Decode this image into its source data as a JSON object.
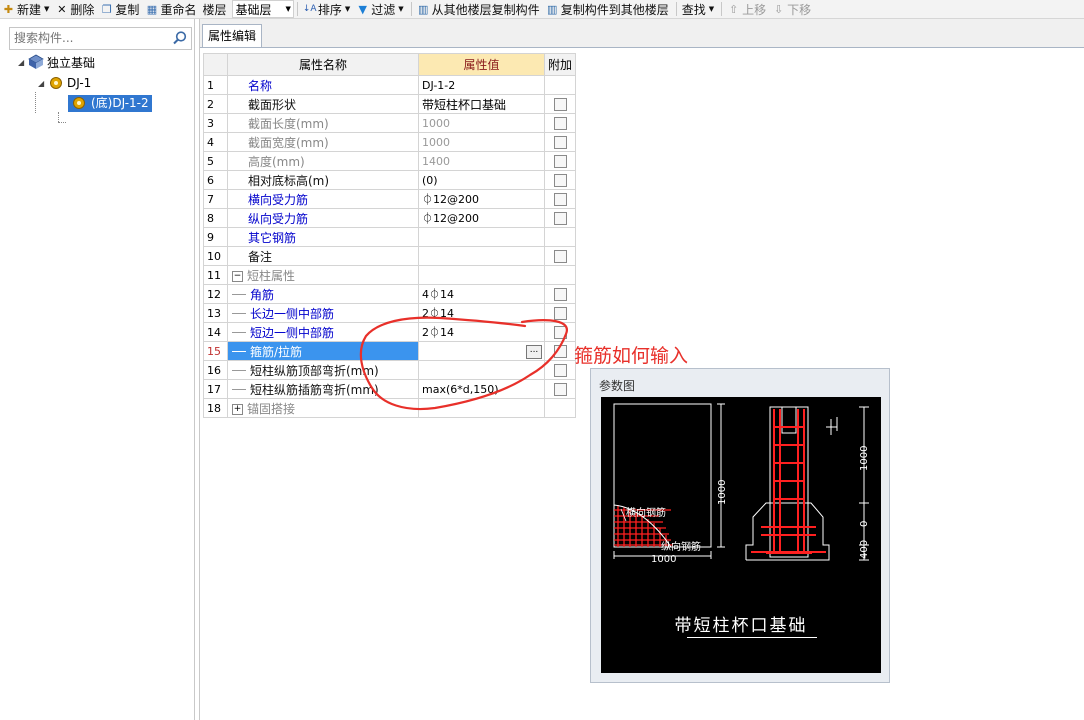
{
  "toolbar": {
    "new": "新建",
    "delete": "删除",
    "copy": "复制",
    "rename": "重命名",
    "floor_label": "楼层",
    "floor_value": "基础层",
    "sort": "排序",
    "filter": "过滤",
    "copy_from_floor": "从其他楼层复制构件",
    "copy_to_floor": "复制构件到其他楼层",
    "find": "查找",
    "move_up": "上移",
    "move_down": "下移"
  },
  "tree": {
    "search_placeholder": "搜索构件...",
    "root": "独立基础",
    "child": "DJ-1",
    "leaf": "(底)DJ-1-2"
  },
  "tabs": {
    "property_edit": "属性编辑"
  },
  "grid": {
    "headers": {
      "name": "属性名称",
      "value": "属性值",
      "extra": "附加"
    },
    "rows": [
      {
        "no": "1",
        "name": "名称",
        "value": "DJ-1-2"
      },
      {
        "no": "2",
        "name": "截面形状",
        "value": "带短柱杯口基础"
      },
      {
        "no": "3",
        "name": "截面长度(mm)",
        "value": "1000"
      },
      {
        "no": "4",
        "name": "截面宽度(mm)",
        "value": "1000"
      },
      {
        "no": "5",
        "name": "高度(mm)",
        "value": "1400"
      },
      {
        "no": "6",
        "name": "相对底标高(m)",
        "value": "(0)"
      },
      {
        "no": "7",
        "name": "横向受力筋",
        "value": "⏀12@200"
      },
      {
        "no": "8",
        "name": "纵向受力筋",
        "value": "⏀12@200"
      },
      {
        "no": "9",
        "name": "其它钢筋",
        "value": ""
      },
      {
        "no": "10",
        "name": "备注",
        "value": ""
      },
      {
        "no": "11",
        "name": "短柱属性",
        "value": ""
      },
      {
        "no": "12",
        "name": "角筋",
        "value": "4⏀14"
      },
      {
        "no": "13",
        "name": "长边一侧中部筋",
        "value": "2⏀14"
      },
      {
        "no": "14",
        "name": "短边一侧中部筋",
        "value": "2⏀14"
      },
      {
        "no": "15",
        "name": "箍筋/拉筋",
        "value": ""
      },
      {
        "no": "16",
        "name": "短柱纵筋顶部弯折(mm)",
        "value": ""
      },
      {
        "no": "17",
        "name": "短柱纵筋插筋弯折(mm)",
        "value": "max(6*d,150)"
      },
      {
        "no": "18",
        "name": "锚固搭接",
        "value": ""
      }
    ],
    "ellipsis": "..."
  },
  "annotation": {
    "text": "箍筋如何输入",
    "color": "#e8302a"
  },
  "param_panel": {
    "title": "参数图",
    "caption": "带短柱杯口基础",
    "label_transverse": "横向钢筋",
    "label_longitudinal": "纵向钢筋",
    "dim_width": "1000",
    "dim_height_left": "1000",
    "dim_height_right": "1000",
    "dim_mid": "0",
    "dim_bottom": "400"
  },
  "colors": {
    "selection": "#3b94ee",
    "header_highlight": "#fce9b2",
    "blue_text": "#0000cc",
    "rebar": "#ff2020"
  }
}
